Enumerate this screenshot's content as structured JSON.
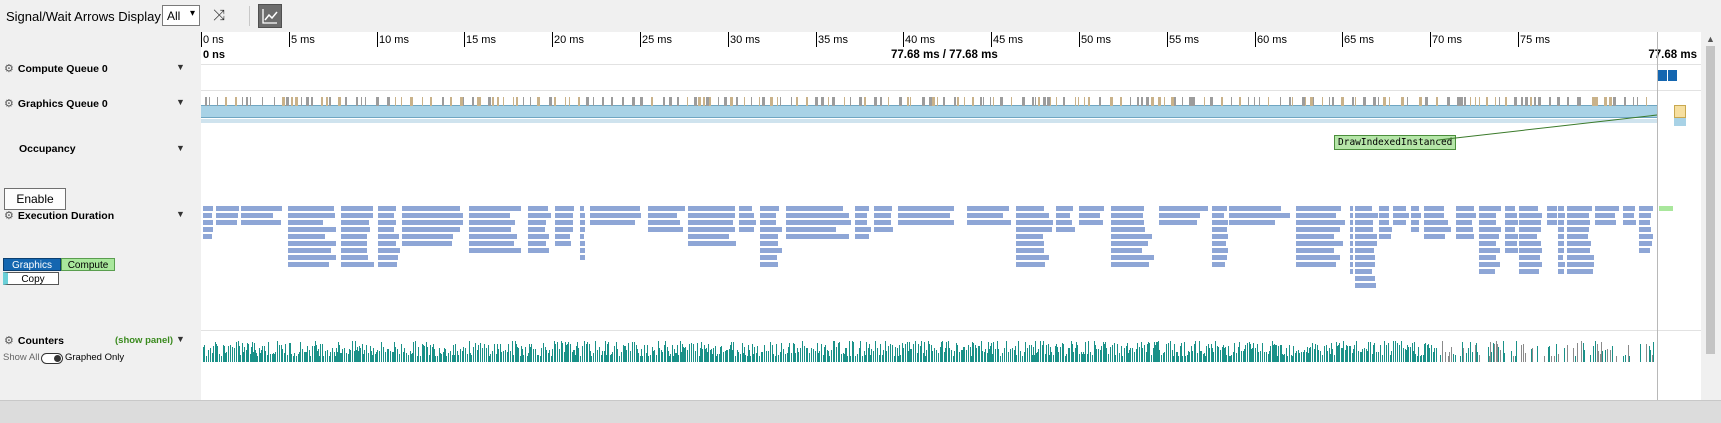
{
  "toolbar": {
    "title": "Signal/Wait Arrows Display",
    "filter_value": "All",
    "filter_arrow": "▾",
    "shuffle_icon": "⤨"
  },
  "ruler": {
    "ticks": [
      "0 ns",
      "5 ms",
      "10 ms",
      "15 ms",
      "20 ms",
      "25 ms",
      "30 ms",
      "35 ms",
      "40 ms",
      "45 ms",
      "50 ms",
      "55 ms",
      "60 ms",
      "65 ms",
      "70 ms",
      "75 ms"
    ],
    "range_start": "0 ns",
    "selection": "77.68 ms / 77.68 ms",
    "range_end": "77.68 ms"
  },
  "rows": {
    "compute_queue": "Compute Queue 0",
    "graphics_queue": "Graphics Queue 0",
    "occupancy": "Occupancy",
    "enable_button": "Enable",
    "execution_duration": "Execution Duration",
    "counters": "Counters",
    "show_panel": "(show panel)"
  },
  "legend": {
    "graphics": "Graphics",
    "compute": "Compute",
    "copy": "Copy"
  },
  "counters_toggle": {
    "show_all": "Show All",
    "graphed_only": "Graphed Only"
  },
  "tooltip": "DrawIndexedInstanced",
  "colors": {
    "graphics": "#1466b0",
    "compute": "#a9e79c",
    "copy": "#6bd0d8",
    "exec_bar": "#8ea6d6",
    "counter_teal": "#1a9188",
    "queue_fill": "#a8d2e6"
  }
}
